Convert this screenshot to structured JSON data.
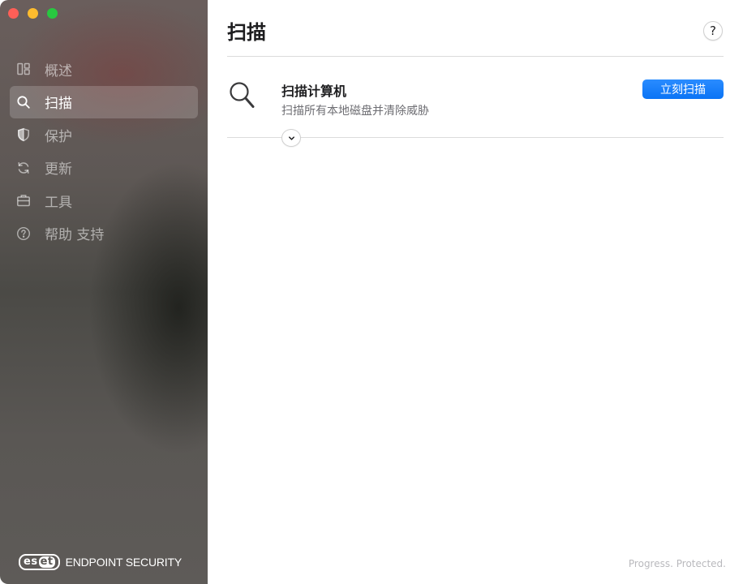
{
  "window": {
    "controls": [
      "close",
      "minimize",
      "zoom"
    ]
  },
  "sidebar": {
    "items": [
      {
        "label": "概述",
        "icon": "overview-icon",
        "active": false
      },
      {
        "label": "扫描",
        "icon": "search-icon",
        "active": true
      },
      {
        "label": "保护",
        "icon": "shield-icon",
        "active": false
      },
      {
        "label": "更新",
        "icon": "refresh-icon",
        "active": false
      },
      {
        "label": "工具",
        "icon": "toolbox-icon",
        "active": false
      },
      {
        "label": "帮助 支持",
        "icon": "question-circle-icon",
        "active": false
      }
    ],
    "brand": {
      "logo_es": "es",
      "logo_et": "et",
      "name": "ENDPOINT SECURITY"
    }
  },
  "main": {
    "title": "扫描",
    "help_label": "?",
    "scan_card": {
      "title": "扫描计算机",
      "description": "扫描所有本地磁盘并清除威胁",
      "button_label": "立刻扫描"
    },
    "footer_tagline": "Progress. Protected."
  },
  "colors": {
    "accent": "#0a74f5",
    "sidebar_active_bg": "rgba(255,255,255,0.18)",
    "traffic_red": "#ff5f57",
    "traffic_yellow": "#febc2e",
    "traffic_green": "#28c840"
  }
}
